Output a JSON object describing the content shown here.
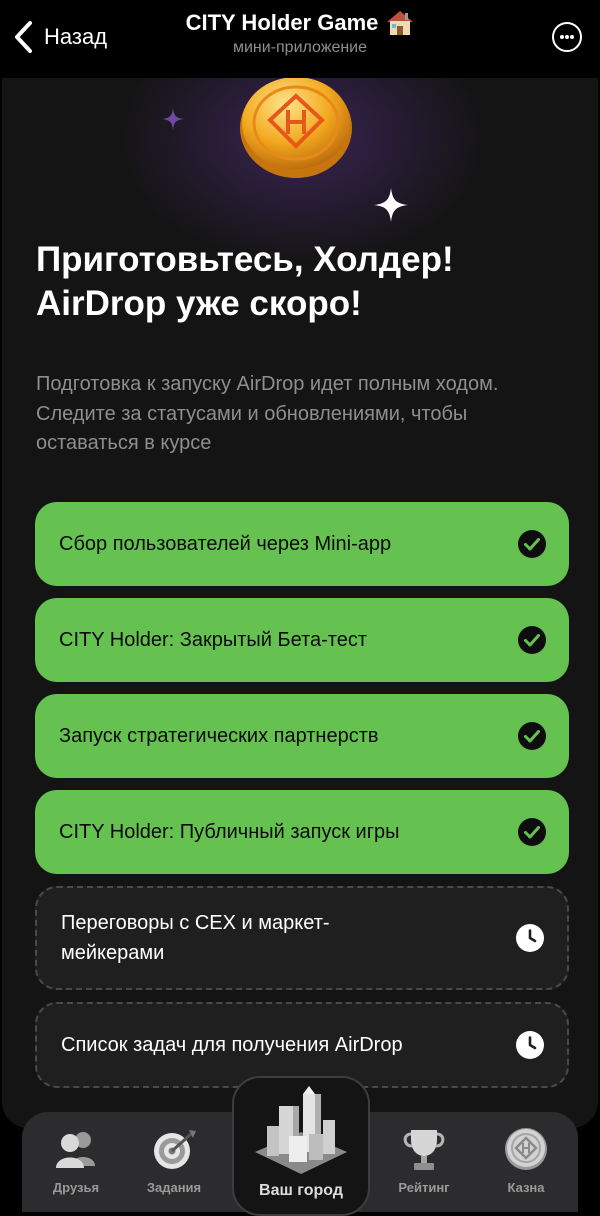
{
  "header": {
    "back_label": "Назад",
    "title": "CITY Holder Game",
    "subtitle": "мини-приложение"
  },
  "hero": {
    "headline_line1": "Приготовьтесь, Холдер!",
    "headline_line2": "AirDrop уже скоро!",
    "description": "Подготовка к запуску AirDrop идет полным ходом. Следите за статусами и обновлениями, чтобы оставаться в курсе"
  },
  "tasks": [
    {
      "label": "Сбор пользователей через Mini-app",
      "status": "done"
    },
    {
      "label": "CITY Holder: Закрытый Бета-тест",
      "status": "done"
    },
    {
      "label": "Запуск стратегических партнерств",
      "status": "done"
    },
    {
      "label": "CITY Holder: Публичный запуск игры",
      "status": "done"
    },
    {
      "label": "Переговоры с CEX и маркет-мейкерами",
      "status": "pending"
    },
    {
      "label": "Список задач для получения AirDrop",
      "status": "pending"
    }
  ],
  "nav": {
    "friends": "Друзья",
    "tasks": "Задания",
    "city": "Ваш город",
    "rating": "Рейтинг",
    "treasury": "Казна"
  },
  "colors": {
    "accent_green": "#66c250",
    "background": "#141414",
    "muted_text": "#8e8e93"
  },
  "icons": [
    "chevron-left-icon",
    "house-emoji-icon",
    "more-icon",
    "coin-logo-icon",
    "sparkle-icon",
    "check-circle-icon",
    "clock-icon",
    "friends-icon",
    "target-icon",
    "city-icon",
    "trophy-icon",
    "coin-icon"
  ]
}
